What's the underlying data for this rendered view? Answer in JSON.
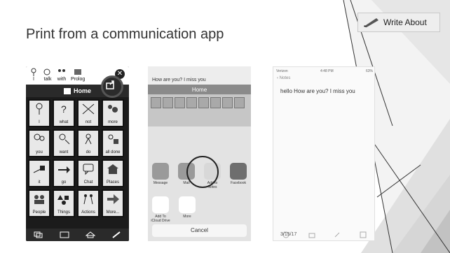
{
  "slide": {
    "title": "Print from a communication app",
    "logo_text": "Write About",
    "colors": {
      "background": "#ffffff",
      "facet_light": "#f0f0f0",
      "facet_mid": "#dcdcdc",
      "facet_dark": "#bdbdbd",
      "arrow": "#bfbfbf"
    }
  },
  "step1": {
    "message_words": [
      "I",
      "talk",
      "with",
      "Prolog"
    ],
    "home_label": "Home",
    "share_icon": "share-icon",
    "cells": [
      "I",
      "what",
      "not",
      "more",
      "you",
      "want",
      "do",
      "all done",
      "it",
      "go",
      "Chat",
      "Places",
      "People",
      "Things",
      "Actions",
      "More..."
    ]
  },
  "step2": {
    "message_text": "How are you?  I  miss  you",
    "home_label": "Home",
    "share_options": [
      "Message",
      "Mail",
      "Add to Notes",
      "Facebook"
    ],
    "more_options": [
      "Add To iCloud Drive",
      "More"
    ],
    "cancel_label": "Cancel"
  },
  "step3": {
    "carrier": "Verizon",
    "time": "4:48 PM",
    "battery": "63%",
    "back_label": "Notes",
    "note_text": "hello How are you?  I miss you",
    "date": "3/15/17"
  }
}
